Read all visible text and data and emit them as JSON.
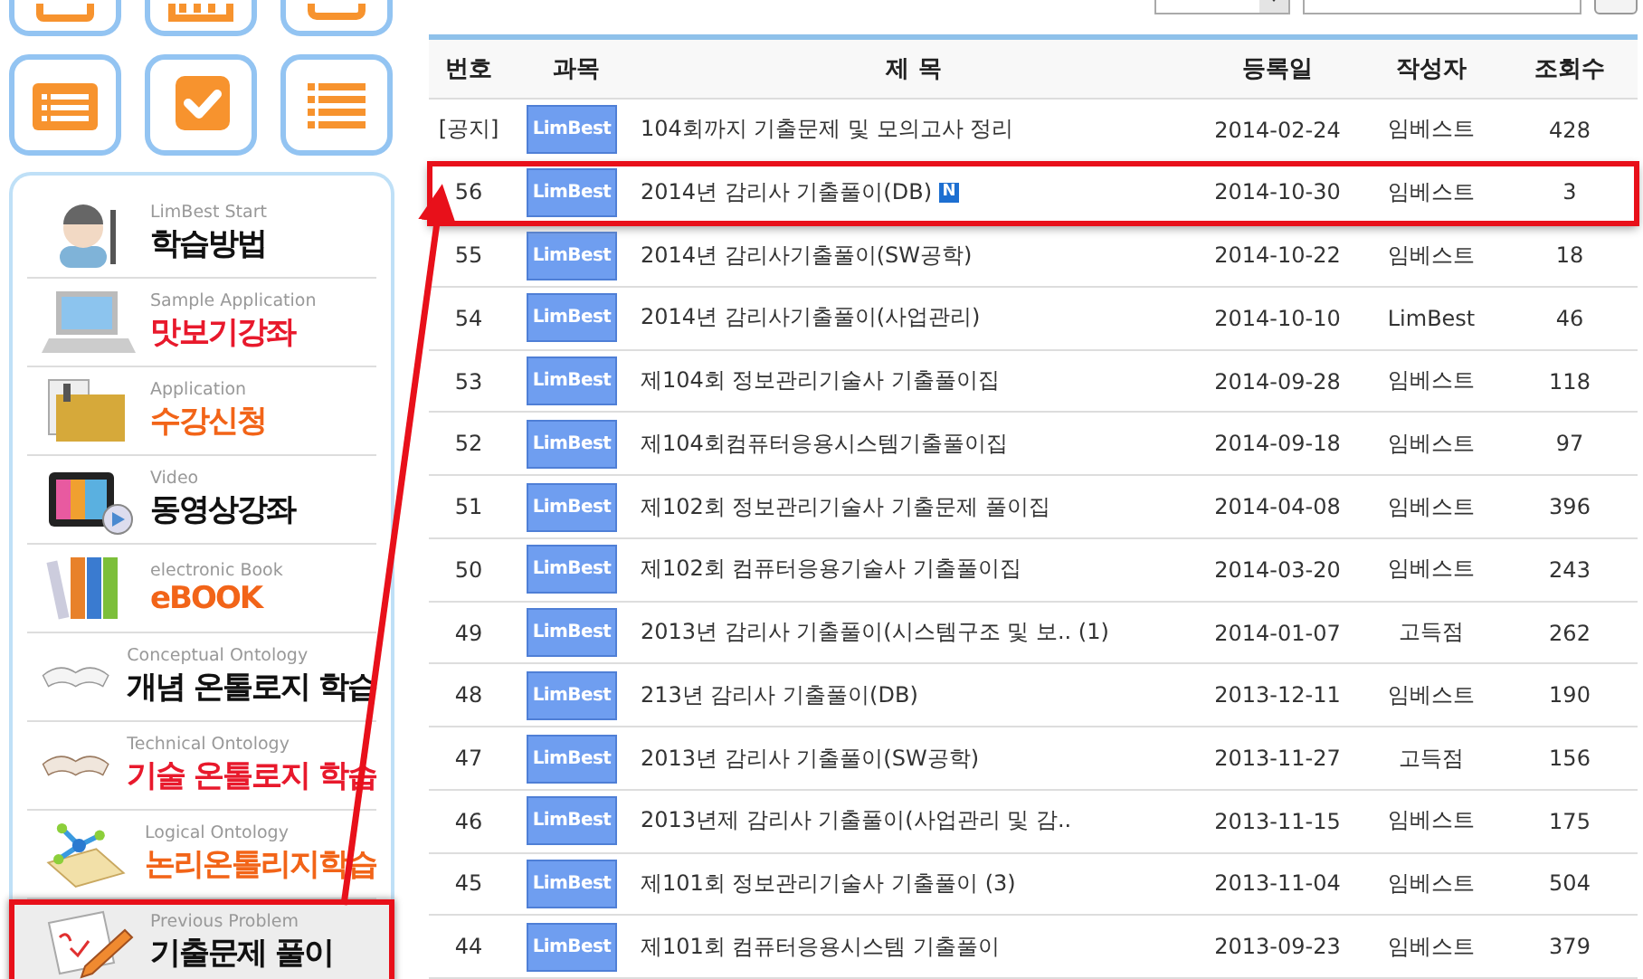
{
  "tiles": [
    {
      "kind": "calendar"
    },
    {
      "kind": "grid"
    },
    {
      "kind": "card"
    },
    {
      "kind": "list-card"
    },
    {
      "kind": "check"
    },
    {
      "kind": "list"
    }
  ],
  "menu": [
    {
      "caption": "LimBest Start",
      "title": "학습방법",
      "color": "#111111",
      "kind": "teacher",
      "highlighted": false
    },
    {
      "caption": "Sample Application",
      "title": "맛보기강좌",
      "color": "#e8192c",
      "kind": "laptop",
      "highlighted": false
    },
    {
      "caption": "Application",
      "title": "수강신청",
      "color": "#f26418",
      "kind": "folder",
      "highlighted": false
    },
    {
      "caption": "Video",
      "title": "동영상강좌",
      "color": "#111111",
      "kind": "tv",
      "highlighted": false
    },
    {
      "caption": "electronic Book",
      "title": "eBOOK",
      "color": "#f26418",
      "kind": "books",
      "highlighted": false
    },
    {
      "caption": "Conceptual Ontology",
      "title": "개념 온톨로지 학습",
      "color": "#111111",
      "kind": "book",
      "highlighted": false
    },
    {
      "caption": "Technical Ontology",
      "title": "기술 온톨로지 학습",
      "color": "#e8192c",
      "kind": "book-brown",
      "highlighted": false
    },
    {
      "caption": "Logical Ontology",
      "title": "논리온톨리지학습",
      "color": "#f26418",
      "kind": "network",
      "highlighted": false
    },
    {
      "caption": "Previous Problem",
      "title": "기출문제 풀이",
      "color": "#111111",
      "kind": "paper",
      "highlighted": true
    }
  ],
  "table": {
    "columns": [
      "번호",
      "과목",
      "제 목",
      "등록일",
      "작성자",
      "조회수"
    ],
    "rows": [
      {
        "number": "[공지]",
        "subject": "LimBest",
        "title": "104회까지 기출문제 및 모의고사 정리",
        "date": "2014-02-24",
        "author": "임베스트",
        "views": "428",
        "highlighted": false
      },
      {
        "number": "56",
        "subject": "LimBest",
        "title": "2014년 감리사 기출풀이(DB)",
        "badge": "N",
        "date": "2014-10-30",
        "author": "임베스트",
        "views": "3",
        "highlighted": true
      },
      {
        "number": "55",
        "subject": "LimBest",
        "title": "2014년 감리사기출풀이(SW공학)",
        "date": "2014-10-22",
        "author": "임베스트",
        "views": "18",
        "highlighted": false
      },
      {
        "number": "54",
        "subject": "LimBest",
        "title": "2014년 감리사기출풀이(사업관리)",
        "date": "2014-10-10",
        "author": "LimBest",
        "views": "46",
        "highlighted": false
      },
      {
        "number": "53",
        "subject": "LimBest",
        "title": "제104회 정보관리기술사 기출풀이집",
        "date": "2014-09-28",
        "author": "임베스트",
        "views": "118",
        "highlighted": false
      },
      {
        "number": "52",
        "subject": "LimBest",
        "title": "제104회컴퓨터응용시스템기출풀이집",
        "date": "2014-09-18",
        "author": "임베스트",
        "views": "97",
        "highlighted": false
      },
      {
        "number": "51",
        "subject": "LimBest",
        "title": "제102회 정보관리기술사 기출문제 풀이집",
        "date": "2014-04-08",
        "author": "임베스트",
        "views": "396",
        "highlighted": false
      },
      {
        "number": "50",
        "subject": "LimBest",
        "title": "제102회 컴퓨터응용기술사 기출풀이집",
        "date": "2014-03-20",
        "author": "임베스트",
        "views": "243",
        "highlighted": false
      },
      {
        "number": "49",
        "subject": "LimBest",
        "title": "2013년 감리사 기출풀이(시스템구조 및 보.. (1)",
        "date": "2014-01-07",
        "author": "고득점",
        "views": "262",
        "highlighted": false
      },
      {
        "number": "48",
        "subject": "LimBest",
        "title": "213년 감리사 기출풀이(DB)",
        "date": "2013-12-11",
        "author": "임베스트",
        "views": "190",
        "highlighted": false
      },
      {
        "number": "47",
        "subject": "LimBest",
        "title": "2013년 감리사 기출풀이(SW공학)",
        "date": "2013-11-27",
        "author": "고득점",
        "views": "156",
        "highlighted": false
      },
      {
        "number": "46",
        "subject": "LimBest",
        "title": "2013년제 감리사 기출풀이(사업관리 및 감..",
        "date": "2013-11-15",
        "author": "임베스트",
        "views": "175",
        "highlighted": false
      },
      {
        "number": "45",
        "subject": "LimBest",
        "title": "제101회 정보관리기술사 기출풀이 (3)",
        "date": "2013-11-04",
        "author": "임베스트",
        "views": "504",
        "highlighted": false
      },
      {
        "number": "44",
        "subject": "LimBest",
        "title": "제101회 컴퓨터응용시스템 기출풀이",
        "date": "2013-09-23",
        "author": "임베스트",
        "views": "379",
        "highlighted": false
      }
    ]
  },
  "annotations": [
    {
      "kind": "arrow"
    }
  ]
}
